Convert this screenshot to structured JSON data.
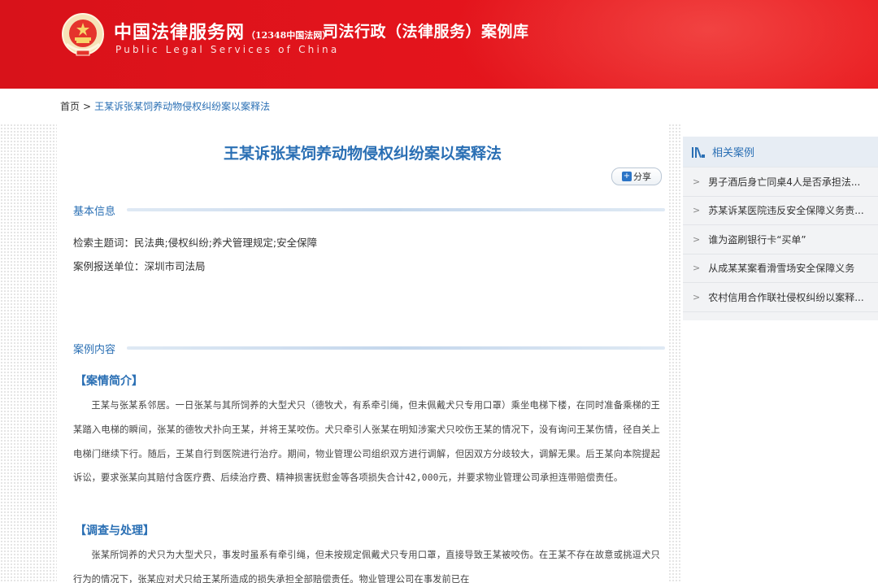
{
  "header": {
    "site_name": "中国法律服务网",
    "site_sub": "（12348中国法网）",
    "site_name_en": "Public Legal Services of China",
    "section_title": "司法行政（法律服务）案例库",
    "brand_color": "#e3141c"
  },
  "breadcrumb": {
    "home": "首页",
    "separator": ">",
    "current": "王某诉张某饲养动物侵权纠纷案以案释法"
  },
  "article": {
    "title": "王某诉张某饲养动物侵权纠纷案以案释法",
    "share_label": "分享",
    "basic_info_label": "基本信息",
    "keywords_row": "检索主题词：民法典;侵权纠纷;养犬管理规定;安全保障",
    "submitter_row": "案例报送单位：深圳市司法局",
    "content_label": "案例内容",
    "case_intro_heading": "【案情简介】",
    "case_intro_text": "王某与张某系邻居。一日张某与其所饲养的大型犬只（德牧犬，有系牵引绳，但未佩戴犬只专用口罩）乘坐电梯下楼，在同时准备乘梯的王某踏入电梯的瞬间，张某的德牧犬扑向王某，并将王某咬伤。犬只牵引人张某在明知涉案犬只咬伤王某的情况下，没有询问王某伤情，径自关上电梯门继续下行。随后，王某自行到医院进行治疗。期间，物业管理公司组织双方进行调解，但因双方分歧较大，调解无果。后王某向本院提起诉讼，要求张某向其赔付含医疗费、后续治疗费、精神损害抚慰金等各项损失合计42,000元，并要求物业管理公司承担连带赔偿责任。",
    "investigation_heading": "【调查与处理】",
    "investigation_text": "张某所饲养的犬只为大型犬只，事发时虽系有牵引绳，但未按规定佩戴犬只专用口罩，直接导致王某被咬伤。在王某不存在故意或挑逗犬只行为的情况下，张某应对犬只给王某所造成的损失承担全部赔偿责任。物业管理公司在事发前已在"
  },
  "sidebar": {
    "title": "相关案例",
    "items": [
      "男子酒后身亡同桌4人是否承担法...",
      "苏某诉某医院违反安全保障义务责...",
      "谁为盗刷银行卡“买单”",
      "从成某某案看滑雪场安全保障义务",
      "农村信用合作联社侵权纠纷以案释..."
    ]
  }
}
